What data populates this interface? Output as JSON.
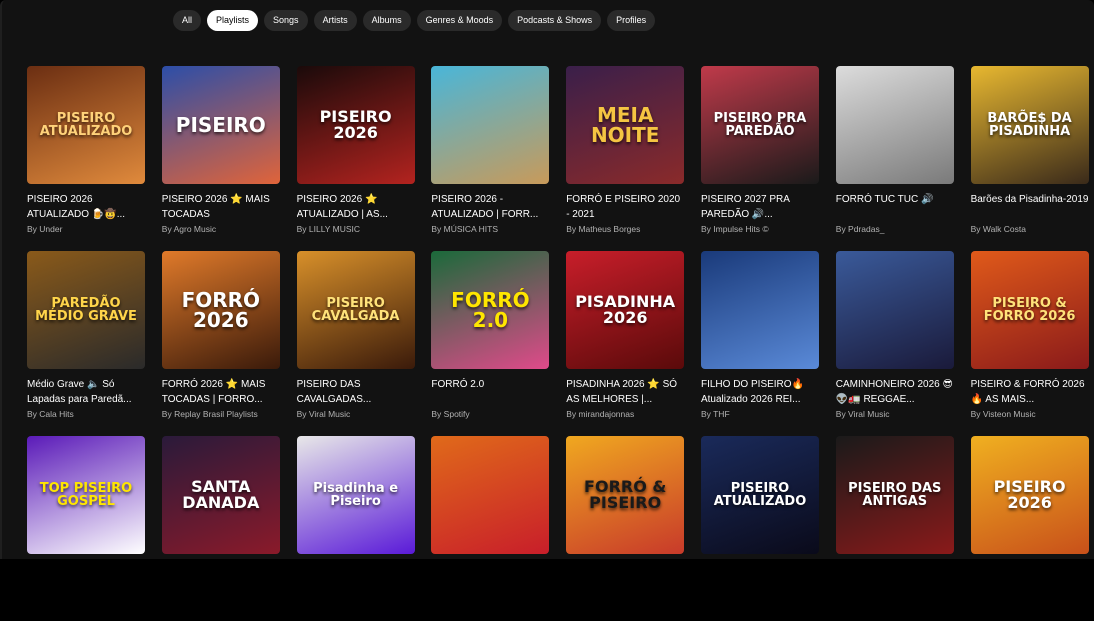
{
  "filters": [
    "All",
    "Playlists",
    "Songs",
    "Artists",
    "Albums",
    "Genres & Moods",
    "Podcasts & Shows",
    "Profiles"
  ],
  "active_filter": "Playlists",
  "cards": [
    {
      "title": "PISEIRO 2026 ATUALIZADO 🍺🤠...",
      "subtitle": "By Under",
      "cover_text": "PISEIRO ATUALIZADO",
      "bg": "#6b2e12",
      "bg2": "#e08a3c",
      "fg": "#ffd27a"
    },
    {
      "title": "PISEIRO 2026 ⭐ MAIS TOCADAS",
      "subtitle": "By Agro Music",
      "cover_text": "PISEIRO",
      "bg": "#2c4ea8",
      "bg2": "#e0643a",
      "fg": "#ffffff"
    },
    {
      "title": "PISEIRO 2026 ⭐ ATUALIZADO | AS...",
      "subtitle": "By LILLY MUSIC",
      "cover_text": "PISEIRO 2026",
      "bg": "#1a0a0a",
      "bg2": "#b3231f",
      "fg": "#ffffff"
    },
    {
      "title": "PISEIRO 2026 - ATUALIZADO | FORR...",
      "subtitle": "By MÚSICA HITS",
      "cover_text": "",
      "bg": "#49b6d9",
      "bg2": "#c89a5a",
      "fg": "#ffffff"
    },
    {
      "title": "FORRÓ E PISEIRO 2020 - 2021",
      "subtitle": "By Matheus Borges",
      "cover_text": "MEIA NOITE",
      "bg": "#3a1f4a",
      "bg2": "#8a2a2a",
      "fg": "#f5c542"
    },
    {
      "title": "PISEIRO 2027 PRA PAREDÃO 🔊...",
      "subtitle": "By Impulse Hits ©",
      "cover_text": "PISEIRO PRA PAREDÃO",
      "bg": "#c03a4a",
      "bg2": "#1a1a1a",
      "fg": "#ffffff"
    },
    {
      "title": "FORRÓ TUC TUC 🔊",
      "subtitle": "By Pdradas_",
      "cover_text": "",
      "bg": "#dcdcdc",
      "bg2": "#7a7a7a",
      "fg": "#ffffff"
    },
    {
      "title": "Barões da Pisadinha-2019",
      "subtitle": "By Walk Costa",
      "cover_text": "BARÕE$ DA PISADINHA",
      "bg": "#e8b830",
      "bg2": "#3a2a1a",
      "fg": "#ffffff"
    },
    {
      "title": "Médio Grave 🔈 Só Lapadas para Paredã...",
      "subtitle": "By Cala Hits",
      "cover_text": "PAREDÃO MÉDIO GRAVE",
      "bg": "#8a5a1a",
      "bg2": "#2a2a2a",
      "fg": "#ffd54a"
    },
    {
      "title": "FORRÓ 2026 ⭐ MAIS TOCADAS | FORRO...",
      "subtitle": "By Replay Brasil Playlists",
      "cover_text": "FORRÓ 2026",
      "bg": "#e07a2a",
      "bg2": "#3a1a0a",
      "fg": "#ffffff"
    },
    {
      "title": "PISEIRO DAS CAVALGADAS...",
      "subtitle": "By Viral Music",
      "cover_text": "PISEIRO CAVALGADA",
      "bg": "#d8902a",
      "bg2": "#3a1a0a",
      "fg": "#ffe27a"
    },
    {
      "title": "FORRÓ 2.0",
      "subtitle": "By Spotify",
      "cover_text": "FORRÓ 2.0",
      "bg": "#1a6a3a",
      "bg2": "#e04a8a",
      "fg": "#ffe600"
    },
    {
      "title": "PISADINHA 2026 ⭐ SÓ AS MELHORES |...",
      "subtitle": "By mirandajonnas",
      "cover_text": "PISADINHA 2026",
      "bg": "#c81e2a",
      "bg2": "#5a0a0a",
      "fg": "#ffffff"
    },
    {
      "title": "FILHO DO PISEIRO🔥 Atualizado 2026 REI...",
      "subtitle": "By THF",
      "cover_text": "",
      "bg": "#1a3a7a",
      "bg2": "#5a8ad8",
      "fg": "#ffffff"
    },
    {
      "title": "CAMINHONEIRO 2026 😎👽🚛 REGGAE...",
      "subtitle": "By Viral Music",
      "cover_text": "",
      "bg": "#3a5a9a",
      "bg2": "#1a1a3a",
      "fg": "#ffffff"
    },
    {
      "title": "PISEIRO & FORRÓ 2026 🔥 AS MAIS...",
      "subtitle": "By Visteon Music",
      "cover_text": "PISEIRO & FORRÓ 2026",
      "bg": "#e05a1a",
      "bg2": "#8a1a1a",
      "fg": "#ffe27a"
    },
    {
      "title": "",
      "subtitle": "",
      "cover_text": "TOP PISEIRO GOSPEL",
      "bg": "#5a1ab8",
      "bg2": "#ffffff",
      "fg": "#ffe600"
    },
    {
      "title": "",
      "subtitle": "",
      "cover_text": "SANTA DANADA",
      "bg": "#2a1a3a",
      "bg2": "#8a1a2a",
      "fg": "#ffffff"
    },
    {
      "title": "",
      "subtitle": "",
      "cover_text": "Pisadinha e Piseiro",
      "bg": "#e8e8e8",
      "bg2": "#5a1ad8",
      "fg": "#ffffff"
    },
    {
      "title": "",
      "subtitle": "",
      "cover_text": "",
      "bg": "#e06a1a",
      "bg2": "#c81e2a",
      "fg": "#ffffff"
    },
    {
      "title": "",
      "subtitle": "",
      "cover_text": "FORRÓ & PISEIRO",
      "bg": "#f0a820",
      "bg2": "#c83a2a",
      "fg": "#1a1a1a"
    },
    {
      "title": "",
      "subtitle": "",
      "cover_text": "PISEIRO ATUALIZADO",
      "bg": "#1a2a5a",
      "bg2": "#0a0a1a",
      "fg": "#ffffff"
    },
    {
      "title": "",
      "subtitle": "",
      "cover_text": "PISEIRO DAS ANTIGAS",
      "bg": "#1a1a1a",
      "bg2": "#8a1a1a",
      "fg": "#ffffff"
    },
    {
      "title": "",
      "subtitle": "",
      "cover_text": "PISEIRO 2026",
      "bg": "#f0b020",
      "bg2": "#c8501a",
      "fg": "#ffffff"
    }
  ]
}
